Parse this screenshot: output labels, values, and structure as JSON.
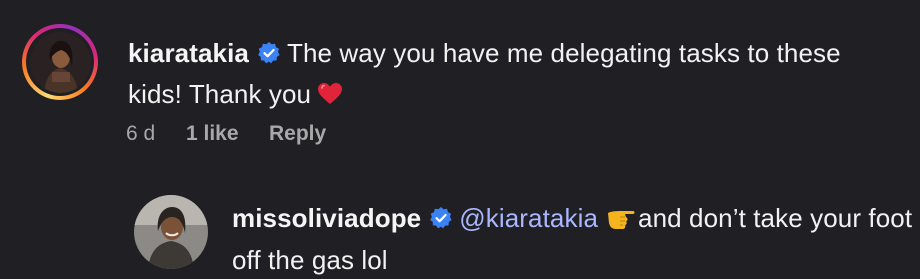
{
  "comments": [
    {
      "username": "kiaratakia",
      "verified": true,
      "text": "The way you have me delegating tasks to these kids! Thank you",
      "emoji": "red-heart",
      "time": "6 d",
      "likes": "1 like",
      "reply_label": "Reply"
    },
    {
      "username": "missoliviadope",
      "verified": true,
      "mention": "@kiaratakia",
      "emoji": "pointing-hand",
      "text": "and don’t take your foot off the gas lol"
    }
  ],
  "colors": {
    "background": "#1f1f24",
    "text": "#f2f2f2",
    "meta": "#a8a8a8",
    "mention": "#aab6ff",
    "verified": "#3b82f6"
  }
}
